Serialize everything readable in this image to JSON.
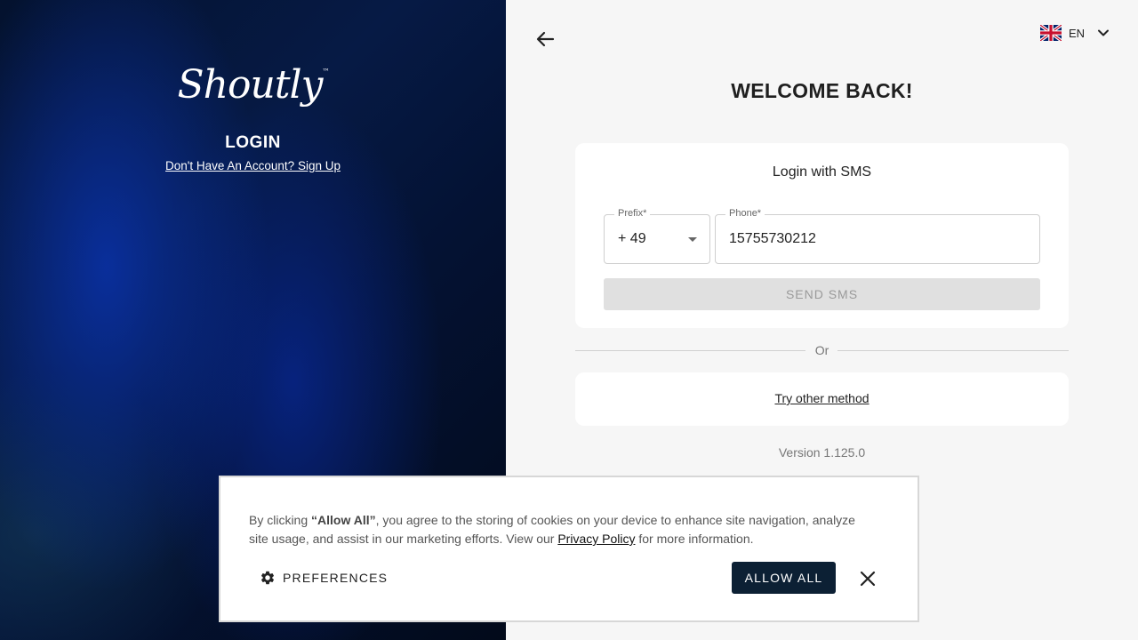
{
  "brand": {
    "logo_text": "Shoutly",
    "tm": "™"
  },
  "left": {
    "title": "LOGIN",
    "signup_link": "Don't Have An Account? Sign Up"
  },
  "header": {
    "language_code": "EN",
    "language_flag": "uk-flag-icon"
  },
  "main": {
    "welcome": "WELCOME BACK!",
    "sms_card": {
      "title": "Login with SMS",
      "prefix_label": "Prefix*",
      "prefix_value": "+ 49",
      "phone_label": "Phone*",
      "phone_value": "15755730212",
      "send_button": "SEND SMS"
    },
    "divider_text": "Or",
    "other_method": "Try other method",
    "version": "Version 1.125.0"
  },
  "cookie": {
    "text_before": "By clicking ",
    "text_bold": "“Allow All”",
    "text_after": ", you agree to the storing of cookies on your device to enhance site navigation, analyze site usage, and assist in our marketing efforts. View our ",
    "privacy_link": "Privacy Policy",
    "text_end": " for more information.",
    "preferences_button": "PREFERENCES",
    "allow_button": "ALLOW ALL"
  },
  "colors": {
    "left_bg": "#04122e",
    "right_bg": "#f6f6f6",
    "primary_button": "#0c2034",
    "disabled_button": "#e0e0e0"
  }
}
